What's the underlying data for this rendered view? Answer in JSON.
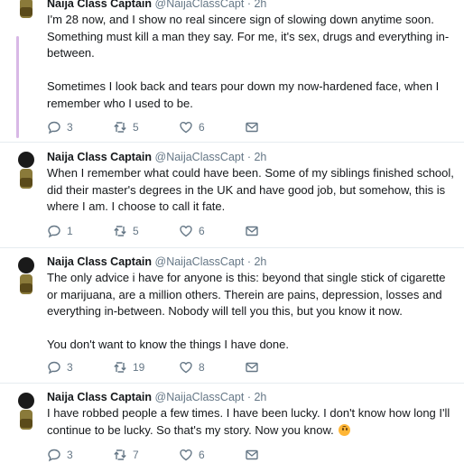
{
  "colors": {
    "thread_line": "#d8b8e6",
    "muted": "#657786",
    "text": "#14171a",
    "divider": "#e6ecf0"
  },
  "icons": {
    "reply": "reply-icon",
    "retweet": "retweet-icon",
    "like": "heart-icon",
    "dm": "envelope-icon",
    "avatar": "avatar-image"
  },
  "tweets": [
    {
      "author": "Naija Class Captain",
      "handle": "@NaijaClassCapt",
      "dot": "·",
      "time": "2h",
      "text": "I'm 28 now, and I show no real sincere sign of slowing down anytime soon. Something must kill a man they say. For me, it's sex, drugs and everything in-between.\n\nSometimes I look back and tears pour down my now-hardened face, when I remember who I used to be.",
      "emoji": "",
      "replies": "3",
      "retweets": "5",
      "likes": "6"
    },
    {
      "author": "Naija Class Captain",
      "handle": "@NaijaClassCapt",
      "dot": "·",
      "time": "2h",
      "text": "When I remember what could have been. Some of my siblings finished school, did their master's degrees in the UK and have good job, but somehow, this is where I am. I choose to call it fate.",
      "emoji": "",
      "replies": "1",
      "retweets": "5",
      "likes": "6"
    },
    {
      "author": "Naija Class Captain",
      "handle": "@NaijaClassCapt",
      "dot": "·",
      "time": "2h",
      "text": "The only advice i have for anyone is this: beyond that single stick of cigarette or marijuana, are a million others. Therein are pains, depression, losses and everything in-between.  Nobody will tell you this, but you know it now.\n\nYou don't want to know the things I have done.",
      "emoji": "",
      "replies": "3",
      "retweets": "19",
      "likes": "8"
    },
    {
      "author": "Naija Class Captain",
      "handle": "@NaijaClassCapt",
      "dot": "·",
      "time": "2h",
      "text": "I have robbed people a few times. I have been lucky. I don't know how long I'll continue to be lucky. So that's my story. Now you know.",
      "emoji": "upside-down-face",
      "replies": "3",
      "retweets": "7",
      "likes": "6"
    }
  ]
}
